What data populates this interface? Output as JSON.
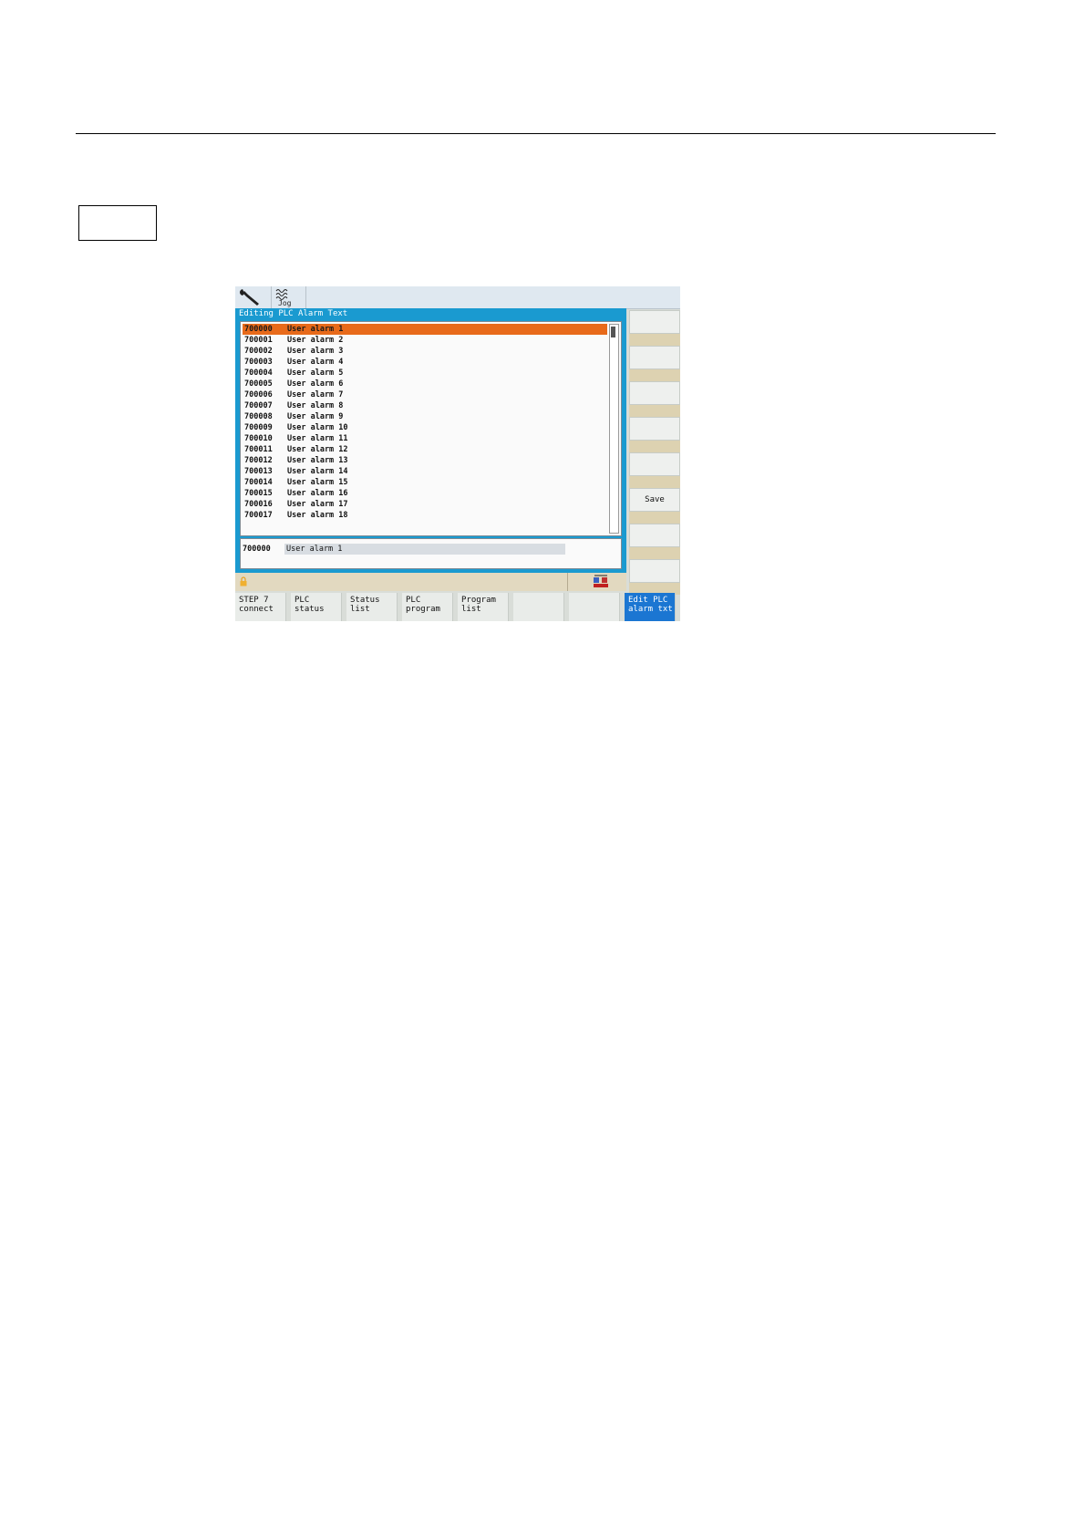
{
  "window": {
    "title": "Editing PLC Alarm Text"
  },
  "topbar": {
    "mode_label": "Jog"
  },
  "alarm_list": [
    {
      "number": "700000",
      "text": "User alarm 1"
    },
    {
      "number": "700001",
      "text": "User alarm 2"
    },
    {
      "number": "700002",
      "text": "User alarm 3"
    },
    {
      "number": "700003",
      "text": "User alarm 4"
    },
    {
      "number": "700004",
      "text": "User alarm 5"
    },
    {
      "number": "700005",
      "text": "User alarm 6"
    },
    {
      "number": "700006",
      "text": "User alarm 7"
    },
    {
      "number": "700007",
      "text": "User alarm 8"
    },
    {
      "number": "700008",
      "text": "User alarm 9"
    },
    {
      "number": "700009",
      "text": "User alarm 10"
    },
    {
      "number": "700010",
      "text": "User alarm 11"
    },
    {
      "number": "700011",
      "text": "User alarm 12"
    },
    {
      "number": "700012",
      "text": "User alarm 13"
    },
    {
      "number": "700013",
      "text": "User alarm 14"
    },
    {
      "number": "700014",
      "text": "User alarm 15"
    },
    {
      "number": "700015",
      "text": "User alarm 16"
    },
    {
      "number": "700016",
      "text": "User alarm 17"
    },
    {
      "number": "700017",
      "text": "User alarm 18"
    }
  ],
  "selected_index": 0,
  "editor": {
    "number": "700000",
    "value": "User alarm 1"
  },
  "vertical_softkeys": [
    "",
    "",
    "",
    "",
    "",
    "Save",
    "",
    ""
  ],
  "horizontal_softkeys": [
    {
      "label": "STEP 7\nconnect",
      "active": false
    },
    {
      "label": "PLC\nstatus",
      "active": false
    },
    {
      "label": "Status\nlist",
      "active": false
    },
    {
      "label": "PLC\nprogram",
      "active": false
    },
    {
      "label": "Program\nlist",
      "active": false
    },
    {
      "label": "",
      "active": false
    },
    {
      "label": "",
      "active": false
    },
    {
      "label": "Edit PLC\nalarm txt",
      "active": true
    }
  ],
  "colors": {
    "selection": "#e86a1a",
    "panel_frame": "#1a9ad0",
    "active_softkey": "#1b76d2"
  },
  "icons": {
    "topbar": [
      "wrench-icon",
      "jog-wave-icon"
    ],
    "statusbar": [
      "lock-icon",
      "channel-flag-icon"
    ]
  }
}
